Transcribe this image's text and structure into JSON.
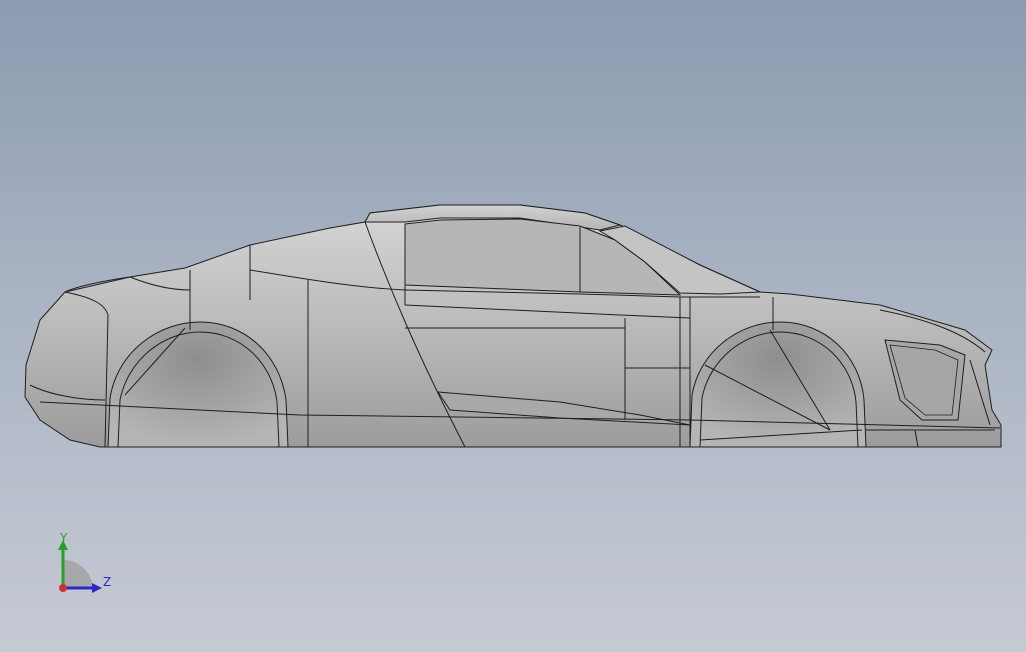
{
  "viewport": {
    "background_top": "#8c9bb0",
    "background_bottom": "#c6cad4",
    "model": {
      "body_color": "#b9b9b9",
      "edge_color": "#1e1e1e"
    }
  },
  "triad": {
    "y_label": "Y",
    "z_label": "Z",
    "y_color": "#2a9e2a",
    "z_color": "#2a2ac0",
    "origin_color": "#c83232",
    "icon": "coordinate-triad-icon"
  }
}
